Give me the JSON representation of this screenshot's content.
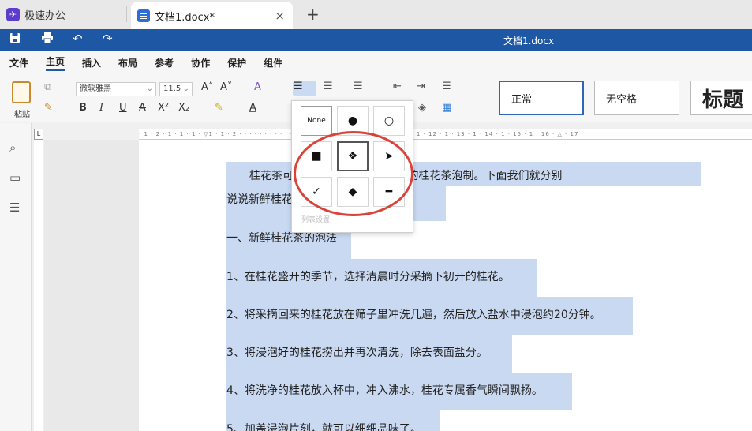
{
  "tabs": {
    "app_name": "极速办公",
    "doc_tab": "文档1.docx*",
    "close": "×",
    "add": "+"
  },
  "titlebar": {
    "title": "文档1.docx"
  },
  "menu": [
    "文件",
    "主页",
    "插入",
    "布局",
    "参考",
    "协作",
    "保护",
    "组件"
  ],
  "ribbon": {
    "paste_label": "粘贴",
    "font_name": "微软雅黑",
    "font_size": "11.5",
    "grow_font": "A˄",
    "shrink_font": "A˅",
    "bold": "B",
    "italic": "I",
    "underline": "U",
    "strike": "A",
    "superscript": "X²",
    "subscript": "X₂",
    "styles": [
      "正常",
      "无空格",
      "标题"
    ]
  },
  "bullet_menu": {
    "none_label": "None",
    "options": [
      "●",
      "○",
      "■",
      "❖",
      "➤",
      "✓",
      "◆",
      "━"
    ],
    "footer": "列表设置"
  },
  "ruler": {
    "h_ticks": "· 1 · 2 · 1 · 1 · 1 · ▽1 · 1 · 2 · · · · · · · · · · · · 7 · 1 · 8 · 1 · 9 · 1 · 10 · 1 · 11 · 1 · 12 · 1 · 13 · 1 · 14 · 1 · 15 · 1 · 16 · △ · 17 ·",
    "corner": "L"
  },
  "document": {
    "paragraphs": [
      "桂花茶可                              也可以用晒干的制作好的桂花茶泡制。下面我们就分别",
      "说说新鲜桂花                          泡。",
      "一、新鲜桂花茶的泡法",
      "1、在桂花盛开的季节，选择清晨时分采摘下初开的桂花。",
      "2、将采摘回来的桂花放在筛子里冲洗几遍，然后放入盐水中浸泡约20分钟。",
      "3、将浸泡好的桂花捞出并再次清洗，除去表面盐分。",
      "4、将洗净的桂花放入杯中，冲入沸水，桂花专属香气瞬间飘扬。",
      "5、加盖浸泡片刻，就可以细细品味了。"
    ]
  }
}
